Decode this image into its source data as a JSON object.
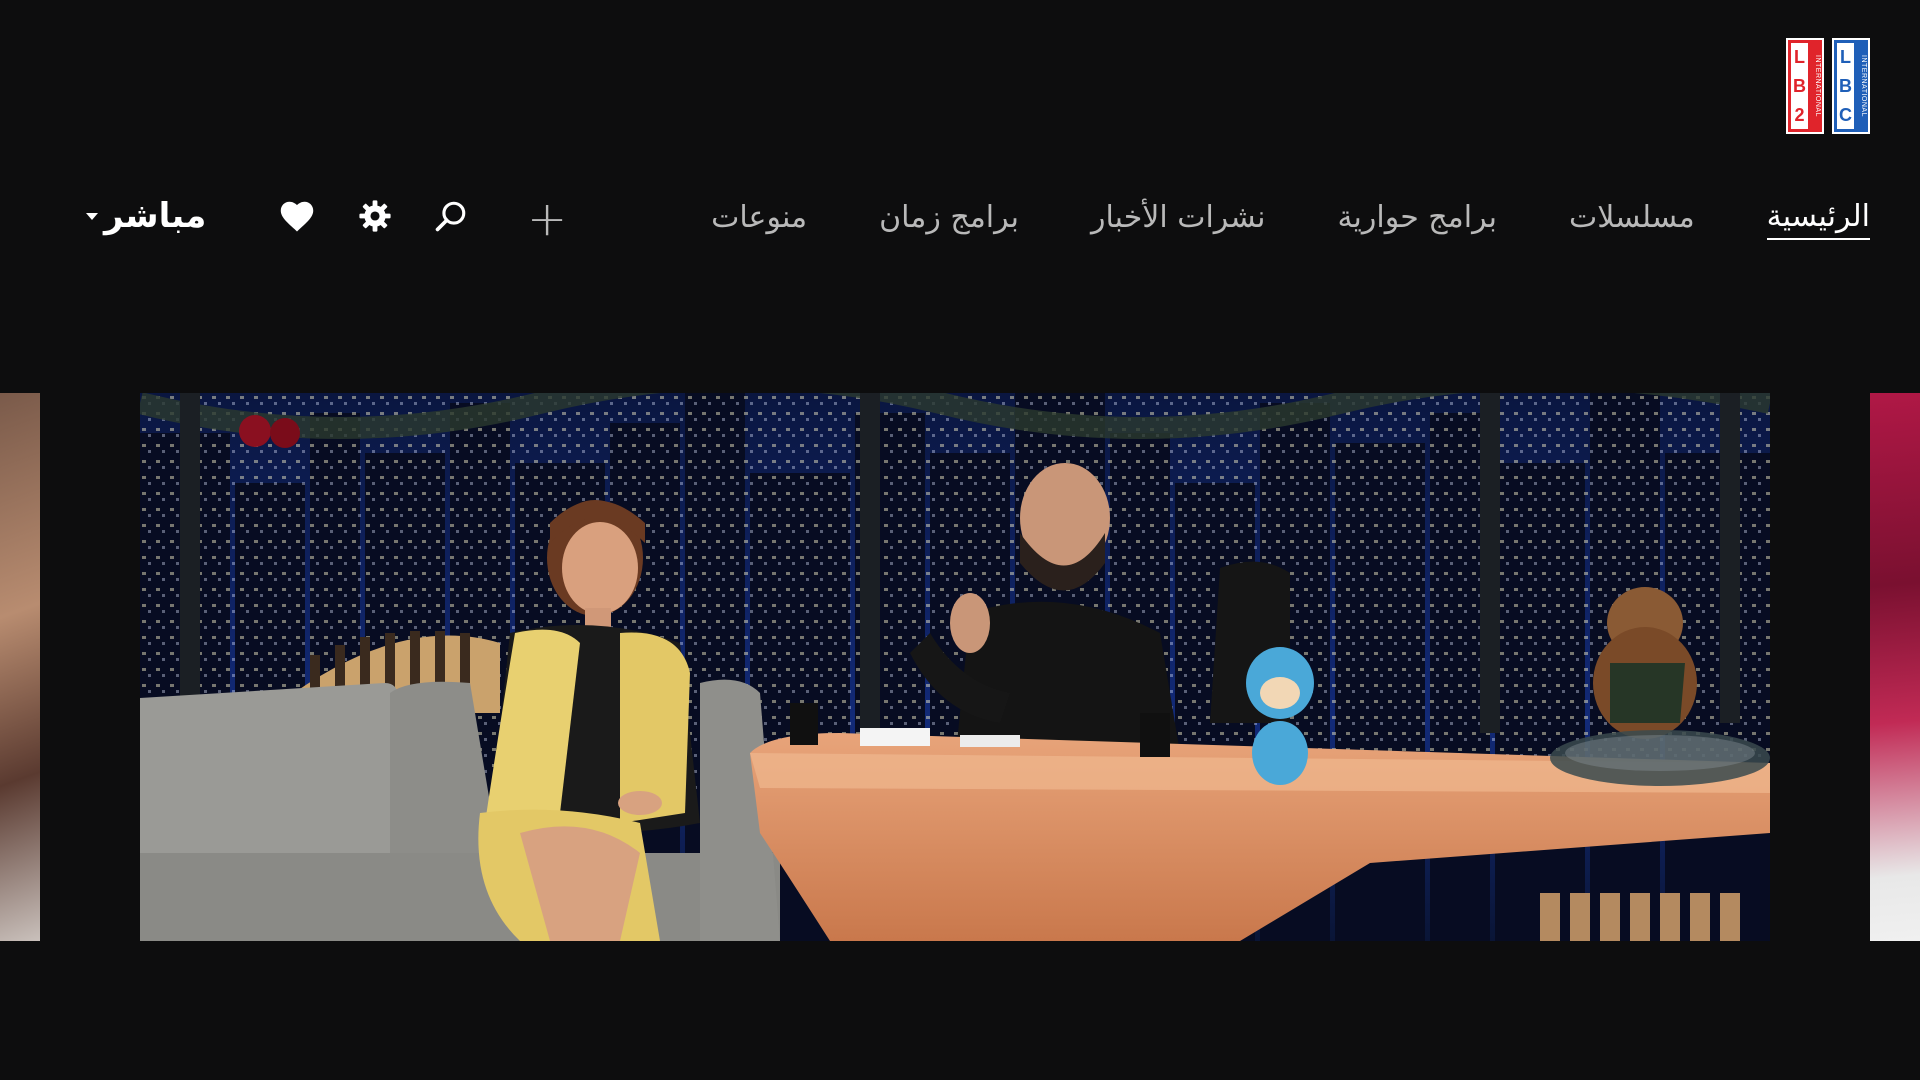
{
  "brand": {
    "logo_letters": [
      "L",
      "B",
      "C"
    ],
    "logo_sub": "INTERNATIONAL",
    "colors": {
      "red": "#e0242b",
      "blue": "#1f5fb8"
    }
  },
  "nav": {
    "items": [
      {
        "label": "الرئيسية",
        "active": true
      },
      {
        "label": "مسلسلات",
        "active": false
      },
      {
        "label": "برامج حوارية",
        "active": false
      },
      {
        "label": "نشرات الأخبار",
        "active": false
      },
      {
        "label": "برامج زمان",
        "active": false
      },
      {
        "label": "منوعات",
        "active": false
      }
    ],
    "more_icon": "plus-icon"
  },
  "toolbar": {
    "search_icon": "search-icon",
    "settings_icon": "gear-icon",
    "favorites_icon": "heart-icon",
    "live_label": "مباشر"
  },
  "carousel": {
    "slides": [
      {
        "id": "peek-left"
      },
      {
        "id": "featured-talk-show"
      },
      {
        "id": "peek-right"
      }
    ]
  }
}
